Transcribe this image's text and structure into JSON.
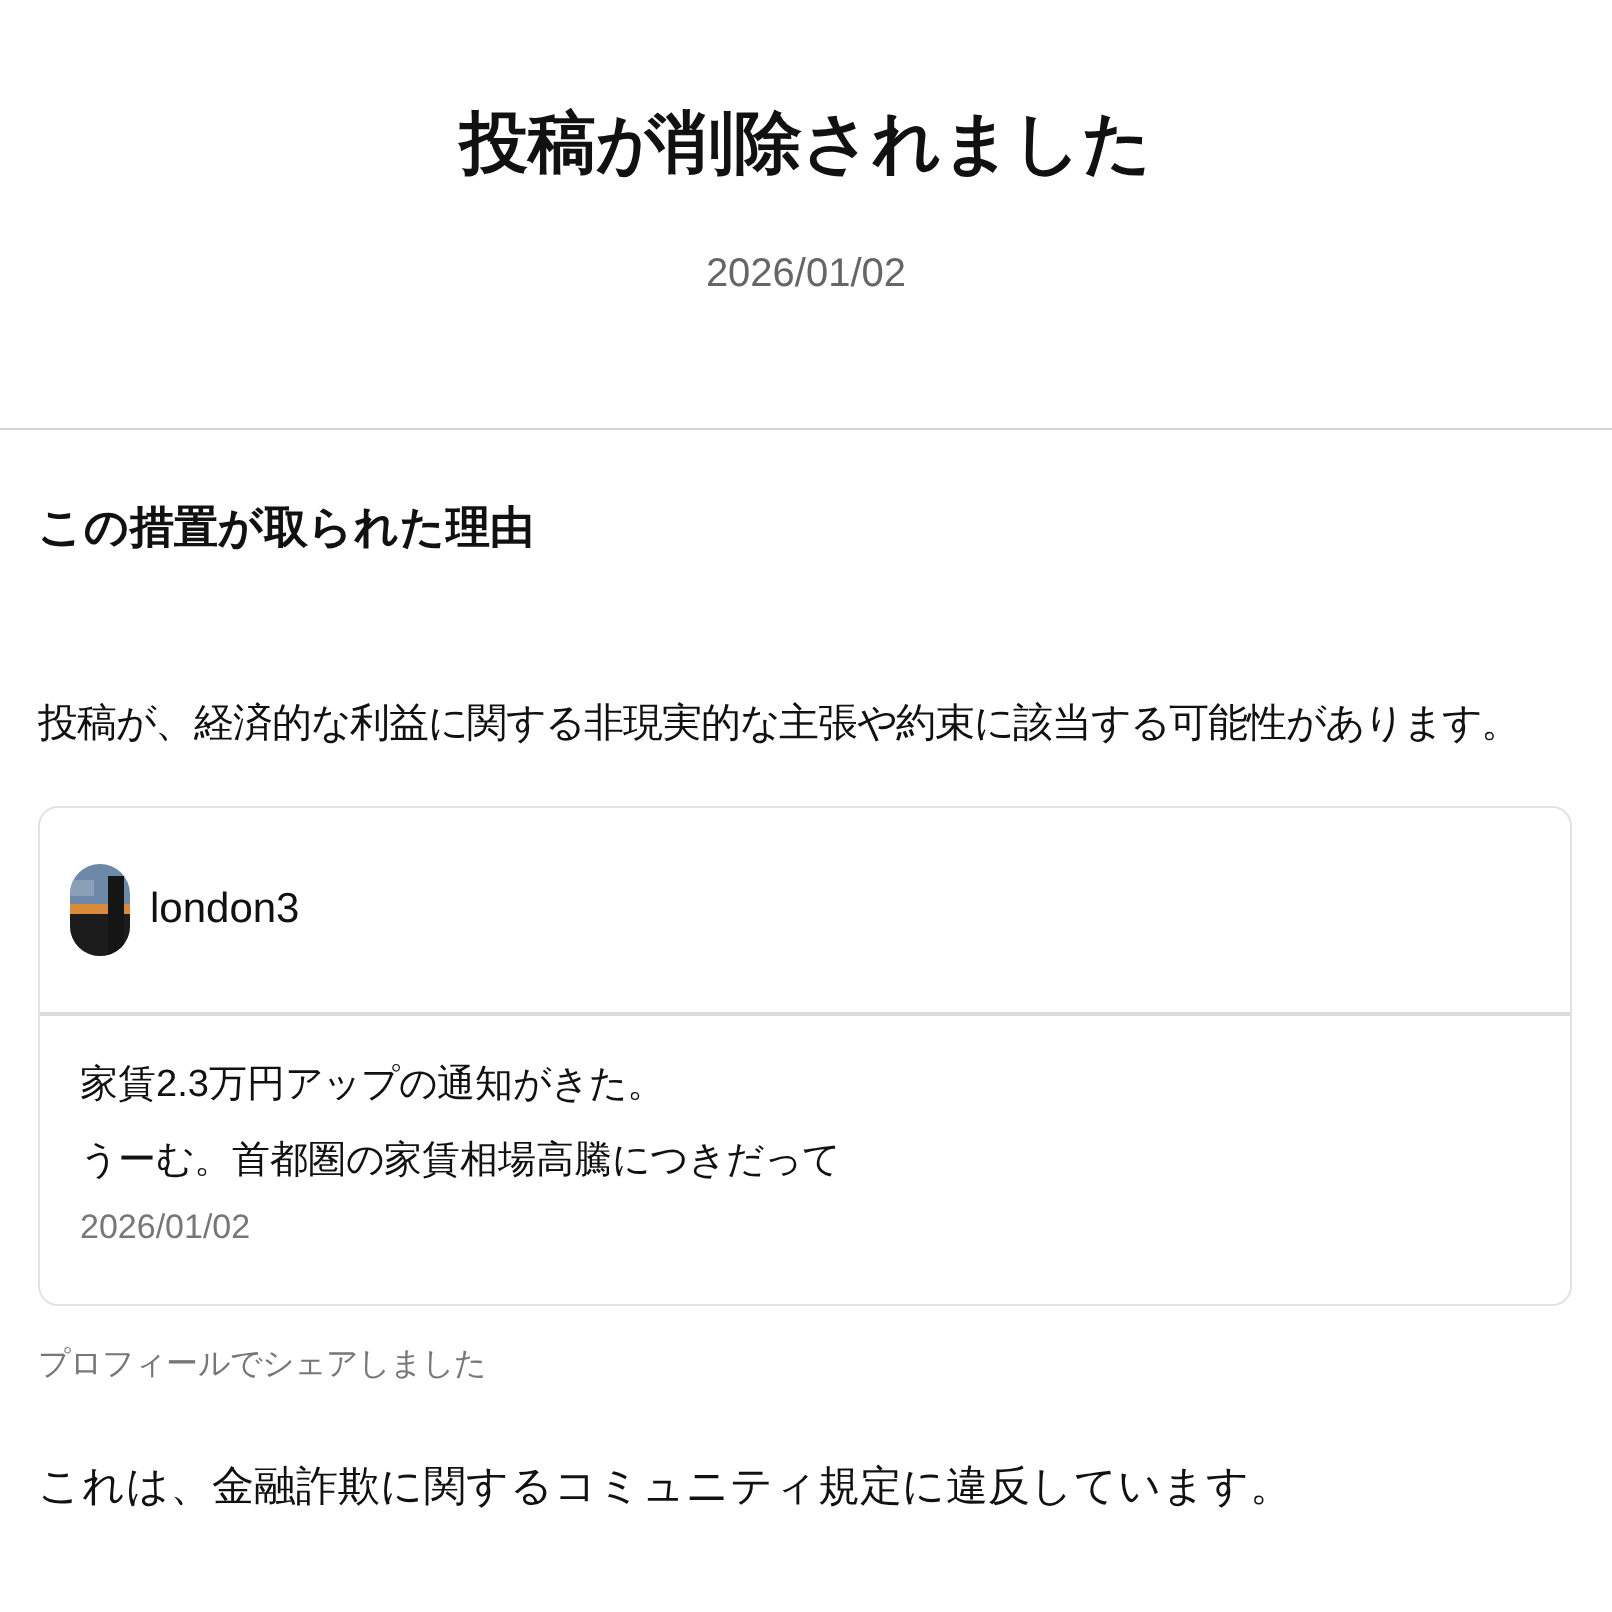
{
  "header": {
    "title": "投稿が削除されました",
    "date": "2026/01/02"
  },
  "reason": {
    "heading": "この措置が取られた理由",
    "text": "投稿が、経済的な利益に関する非現実的な主張や約束に該当する可能性があります。"
  },
  "post": {
    "username": "london3",
    "lines": [
      "家賃2.3万円アップの通知がきた。",
      "うーむ。首都圏の家賃相場高騰につきだって"
    ],
    "date": "2026/01/02"
  },
  "shared_note": "プロフィールでシェアしました",
  "violation": "これは、金融詐欺に関するコミュニティ規定に違反しています。"
}
